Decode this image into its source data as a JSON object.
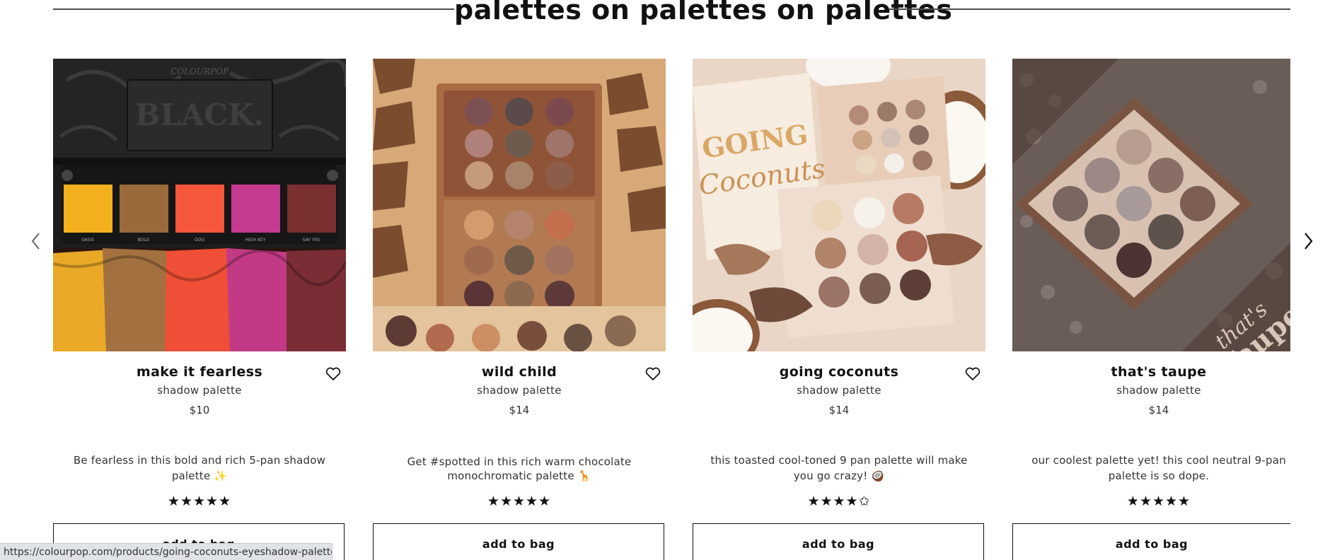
{
  "section": {
    "title": "palettes on palettes on palettes"
  },
  "carousel": {
    "prev_icon": "chevron-left-icon",
    "next_icon": "chevron-right-icon"
  },
  "products": [
    {
      "name": "make it fearless",
      "subtitle": "shadow palette",
      "price": "$10",
      "description": "Be fearless in this bold and rich 5-pan shadow palette ✨",
      "rating_stars": "★★★★★",
      "rating": 5,
      "cta": "add to bag",
      "image_labels": {
        "brand": "COLOURPOP",
        "box_title": "BLACK.",
        "shades": [
          "OASIS",
          "BOLD",
          "OOO",
          "HIGH KEY",
          "SAY YES"
        ]
      }
    },
    {
      "name": "wild child",
      "subtitle": "shadow palette",
      "price": "$14",
      "description": "Get #spotted in this rich warm chocolate monochromatic palette 🦒",
      "rating_stars": "★★★★★",
      "rating": 5,
      "cta": "add to bag"
    },
    {
      "name": "going coconuts",
      "subtitle": "shadow palette",
      "price": "$14",
      "description": "this toasted cool-toned 9 pan palette will make you go crazy! 🥥",
      "rating_stars": "★★★★✩",
      "rating": 4.5,
      "cta": "add to bag",
      "image_labels": {
        "box_title_1": "GOING",
        "box_title_2": "Coconuts"
      }
    },
    {
      "name": "that's taupe",
      "subtitle": "shadow palette",
      "price": "$14",
      "description": "our coolest palette yet! this cool neutral 9-pan palette is so dope.",
      "rating_stars": "★★★★★",
      "rating": 5,
      "cta": "add to bag",
      "image_labels": {
        "box_title_1": "that's",
        "box_title_2": "Taupe"
      }
    }
  ],
  "status_bar": {
    "url": "https://colourpop.com/products/going-coconuts-eyeshadow-palette"
  },
  "colors": {
    "text": "#111111",
    "rule": "#4a4a4a",
    "status_bg": "#dfe3e8"
  }
}
